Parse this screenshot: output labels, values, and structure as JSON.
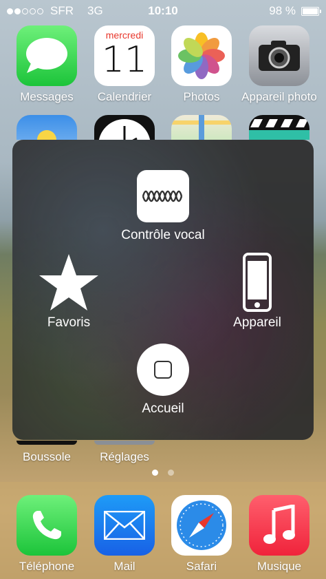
{
  "status_bar": {
    "carrier": "SFR",
    "network": "3G",
    "time": "10:10",
    "battery": "98 %",
    "battery_level": 0.98,
    "signal_bars": 2
  },
  "home_grid": [
    {
      "label": "Messages",
      "icon": "messages-icon"
    },
    {
      "label": "Calendrier",
      "icon": "calendar-icon",
      "weekday": "mercredi",
      "day": "11"
    },
    {
      "label": "Photos",
      "icon": "photos-icon"
    },
    {
      "label": "Appareil photo",
      "icon": "camera-icon"
    }
  ],
  "partial_row": [
    {
      "icon": "weather-icon"
    },
    {
      "icon": "clock-icon"
    },
    {
      "icon": "maps-icon"
    },
    {
      "icon": "videos-icon"
    }
  ],
  "bottom_row": [
    {
      "label": "Boussole"
    },
    {
      "label": "Réglages"
    }
  ],
  "assistive_touch": {
    "voice_control": "Contrôle vocal",
    "favorites": "Favoris",
    "device": "Appareil",
    "home": "Accueil"
  },
  "page_indicator": {
    "count": 2,
    "active": 0
  },
  "dock": [
    {
      "label": "Téléphone",
      "icon": "phone-icon"
    },
    {
      "label": "Mail",
      "icon": "mail-icon"
    },
    {
      "label": "Safari",
      "icon": "safari-icon"
    },
    {
      "label": "Musique",
      "icon": "music-icon"
    }
  ],
  "colors": {
    "messages_green": "#1cc43a",
    "calendar_red": "#e8372c",
    "mail_blue": "#1861e6",
    "music_red": "#f0233b"
  }
}
